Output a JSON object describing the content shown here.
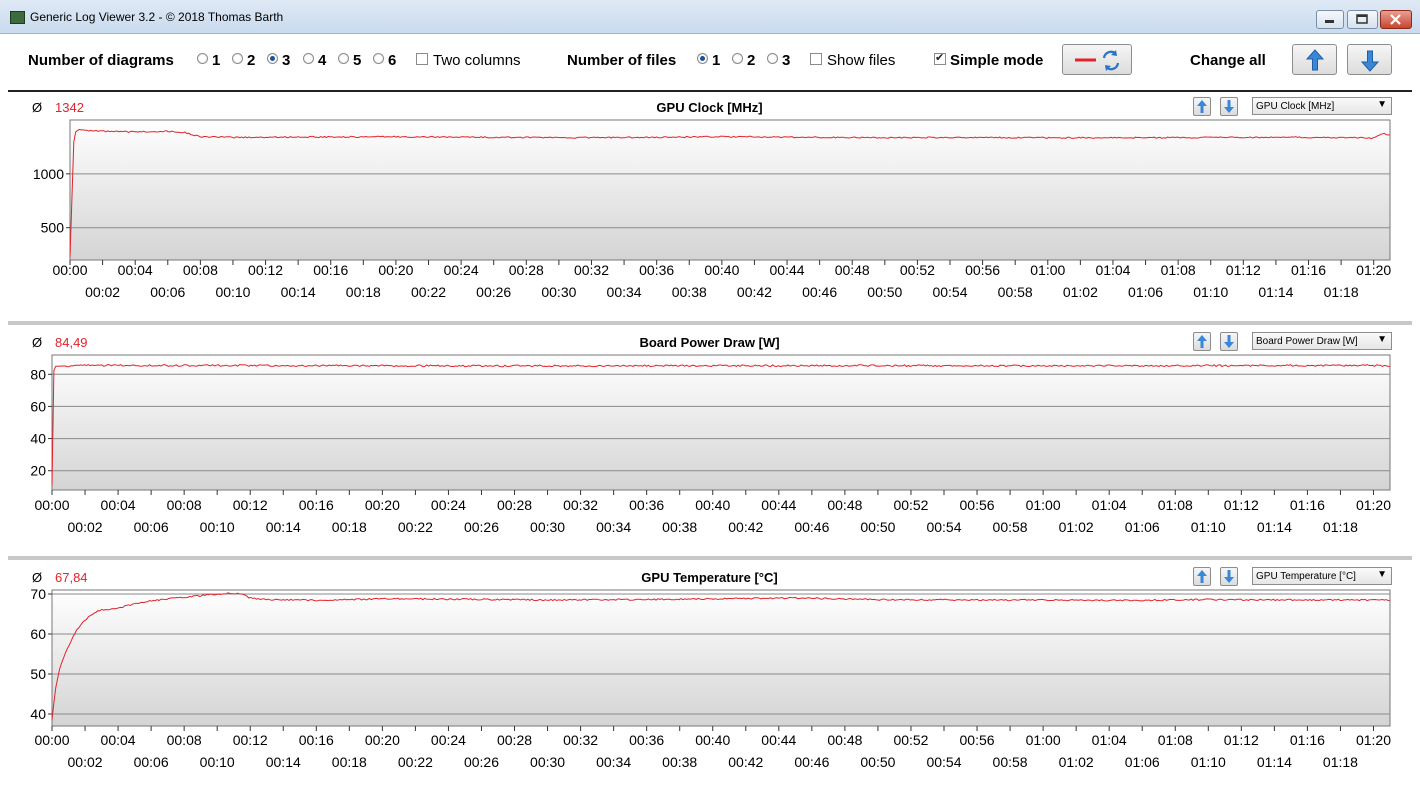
{
  "window": {
    "title": "Generic Log Viewer 3.2 - © 2018 Thomas Barth"
  },
  "toolbar": {
    "num_diagrams_label": "Number of diagrams",
    "diagram_options": [
      "1",
      "2",
      "3",
      "4",
      "5",
      "6"
    ],
    "diagram_selected": "3",
    "two_columns_label": "Two columns",
    "two_columns_checked": false,
    "num_files_label": "Number of files",
    "file_options": [
      "1",
      "2",
      "3"
    ],
    "file_selected": "1",
    "show_files_label": "Show files",
    "show_files_checked": false,
    "simple_mode_label": "Simple mode",
    "simple_mode_checked": true,
    "change_all_label": "Change all",
    "line_color": "#e2232c"
  },
  "chart_data": [
    {
      "type": "line",
      "title": "GPU Clock [MHz]",
      "average_symbol": "Ø",
      "average": "1342",
      "selector": "GPU Clock [MHz]",
      "ylim": [
        200,
        1500
      ],
      "yticks": [
        1000,
        500
      ],
      "x_start_minutes": 0,
      "x_end_minutes": 81,
      "xticks_top": [
        "00:00",
        "00:04",
        "00:08",
        "00:12",
        "00:16",
        "00:20",
        "00:24",
        "00:28",
        "00:32",
        "00:36",
        "00:40",
        "00:44",
        "00:48",
        "00:52",
        "00:56",
        "01:00",
        "01:04",
        "01:08",
        "01:12",
        "01:16",
        "01:20"
      ],
      "xticks_bottom": [
        "00:02",
        "00:06",
        "00:10",
        "00:14",
        "00:18",
        "00:22",
        "00:26",
        "00:30",
        "00:34",
        "00:38",
        "00:42",
        "00:46",
        "00:50",
        "00:54",
        "00:58",
        "01:02",
        "01:06",
        "01:10",
        "01:14",
        "01:18"
      ],
      "series": [
        {
          "color": "#e2232c",
          "points": [
            [
              0,
              230
            ],
            [
              0.25,
              1380
            ],
            [
              0.6,
              1415
            ],
            [
              1,
              1400
            ],
            [
              2,
              1395
            ],
            [
              3,
              1392
            ],
            [
              4,
              1390
            ],
            [
              5,
              1393
            ],
            [
              6,
              1395
            ],
            [
              7,
              1385
            ],
            [
              8,
              1345
            ],
            [
              10,
              1338
            ],
            [
              14,
              1342
            ],
            [
              20,
              1344
            ],
            [
              25,
              1340
            ],
            [
              30,
              1336
            ],
            [
              35,
              1338
            ],
            [
              40,
              1345
            ],
            [
              45,
              1340
            ],
            [
              50,
              1336
            ],
            [
              55,
              1338
            ],
            [
              60,
              1335
            ],
            [
              65,
              1335
            ],
            [
              70,
              1338
            ],
            [
              75,
              1340
            ],
            [
              79,
              1335
            ],
            [
              80,
              1330
            ],
            [
              80.5,
              1375
            ],
            [
              81,
              1360
            ]
          ]
        }
      ]
    },
    {
      "type": "line",
      "title": "Board Power Draw [W]",
      "average_symbol": "Ø",
      "average": "84,49",
      "selector": "Board Power Draw [W]",
      "ylim": [
        8,
        92
      ],
      "yticks": [
        80,
        60,
        40,
        20
      ],
      "x_start_minutes": 0,
      "x_end_minutes": 81,
      "xticks_top": [
        "00:00",
        "00:04",
        "00:08",
        "00:12",
        "00:16",
        "00:20",
        "00:24",
        "00:28",
        "00:32",
        "00:36",
        "00:40",
        "00:44",
        "00:48",
        "00:52",
        "00:56",
        "01:00",
        "01:04",
        "01:08",
        "01:12",
        "01:16",
        "01:20"
      ],
      "xticks_bottom": [
        "00:02",
        "00:06",
        "00:10",
        "00:14",
        "00:18",
        "00:22",
        "00:26",
        "00:30",
        "00:34",
        "00:38",
        "00:42",
        "00:46",
        "00:50",
        "00:54",
        "00:58",
        "01:02",
        "01:06",
        "01:10",
        "01:14",
        "01:18"
      ],
      "series": [
        {
          "color": "#e2232c",
          "points": [
            [
              0,
              11
            ],
            [
              0.12,
              85
            ],
            [
              2,
              85.5
            ],
            [
              10,
              85.5
            ],
            [
              20,
              85.3
            ],
            [
              30,
              85.2
            ],
            [
              40,
              85.3
            ],
            [
              50,
              85.4
            ],
            [
              60,
              85.2
            ],
            [
              70,
              85.4
            ],
            [
              80,
              85.5
            ],
            [
              81,
              85
            ]
          ]
        }
      ]
    },
    {
      "type": "line",
      "title": "GPU Temperature [°C]",
      "average_symbol": "Ø",
      "average": "67,84",
      "selector": "GPU Temperature [°C]",
      "ylim": [
        37,
        71
      ],
      "yticks": [
        70,
        60,
        50,
        40
      ],
      "x_start_minutes": 0,
      "x_end_minutes": 81,
      "xticks_top": [
        "00:00",
        "00:04",
        "00:08",
        "00:12",
        "00:16",
        "00:20",
        "00:24",
        "00:28",
        "00:32",
        "00:36",
        "00:40",
        "00:44",
        "00:48",
        "00:52",
        "00:56",
        "01:00",
        "01:04",
        "01:08",
        "01:12",
        "01:16",
        "01:20"
      ],
      "xticks_bottom": [
        "00:02",
        "00:06",
        "00:10",
        "00:14",
        "00:18",
        "00:22",
        "00:26",
        "00:30",
        "00:34",
        "00:38",
        "00:42",
        "00:46",
        "00:50",
        "00:54",
        "00:58",
        "01:02",
        "01:06",
        "01:10",
        "01:14",
        "01:18"
      ],
      "series": [
        {
          "color": "#e2232c",
          "points": [
            [
              0,
              38.5
            ],
            [
              0.2,
              46
            ],
            [
              0.5,
              52
            ],
            [
              1,
              57
            ],
            [
              1.5,
              61
            ],
            [
              2,
              63.5
            ],
            [
              2.6,
              65.5
            ],
            [
              3,
              66
            ],
            [
              4,
              66.5
            ],
            [
              5,
              67.5
            ],
            [
              6,
              68.3
            ],
            [
              7,
              68.8
            ],
            [
              8,
              69.2
            ],
            [
              9,
              69.6
            ],
            [
              10,
              70
            ],
            [
              11,
              70.2
            ],
            [
              11.5,
              70
            ],
            [
              12,
              69
            ],
            [
              13,
              68.6
            ],
            [
              16,
              68.4
            ],
            [
              20,
              68.8
            ],
            [
              25,
              68.7
            ],
            [
              30,
              68.5
            ],
            [
              35,
              68.6
            ],
            [
              40,
              68.8
            ],
            [
              45,
              69
            ],
            [
              50,
              68.6
            ],
            [
              55,
              68.5
            ],
            [
              60,
              68.5
            ],
            [
              65,
              68.4
            ],
            [
              70,
              68.6
            ],
            [
              75,
              68.5
            ],
            [
              81,
              68.5
            ]
          ]
        }
      ]
    }
  ]
}
